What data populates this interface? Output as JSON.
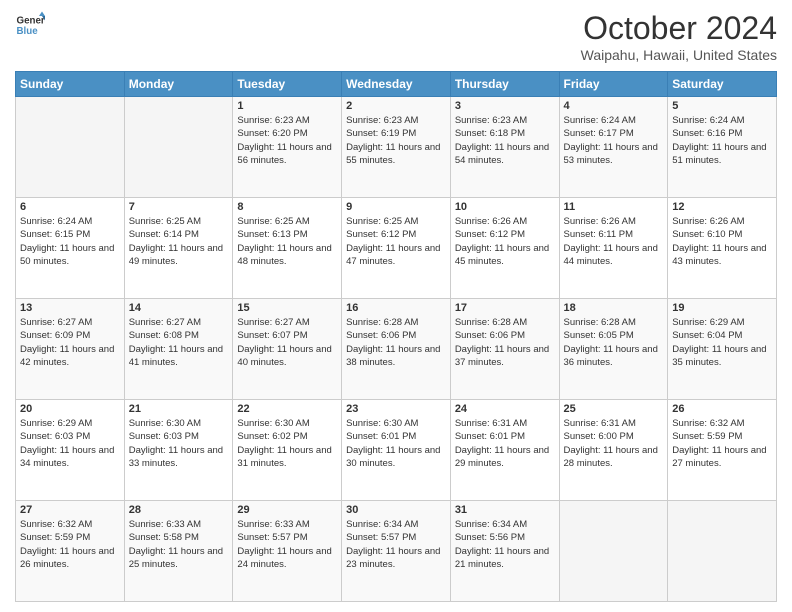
{
  "logo": {
    "line1": "General",
    "line2": "Blue"
  },
  "header": {
    "month": "October 2024",
    "location": "Waipahu, Hawaii, United States"
  },
  "days_of_week": [
    "Sunday",
    "Monday",
    "Tuesday",
    "Wednesday",
    "Thursday",
    "Friday",
    "Saturday"
  ],
  "weeks": [
    [
      {
        "day": "",
        "sunrise": "",
        "sunset": "",
        "daylight": ""
      },
      {
        "day": "",
        "sunrise": "",
        "sunset": "",
        "daylight": ""
      },
      {
        "day": "1",
        "sunrise": "Sunrise: 6:23 AM",
        "sunset": "Sunset: 6:20 PM",
        "daylight": "Daylight: 11 hours and 56 minutes."
      },
      {
        "day": "2",
        "sunrise": "Sunrise: 6:23 AM",
        "sunset": "Sunset: 6:19 PM",
        "daylight": "Daylight: 11 hours and 55 minutes."
      },
      {
        "day": "3",
        "sunrise": "Sunrise: 6:23 AM",
        "sunset": "Sunset: 6:18 PM",
        "daylight": "Daylight: 11 hours and 54 minutes."
      },
      {
        "day": "4",
        "sunrise": "Sunrise: 6:24 AM",
        "sunset": "Sunset: 6:17 PM",
        "daylight": "Daylight: 11 hours and 53 minutes."
      },
      {
        "day": "5",
        "sunrise": "Sunrise: 6:24 AM",
        "sunset": "Sunset: 6:16 PM",
        "daylight": "Daylight: 11 hours and 51 minutes."
      }
    ],
    [
      {
        "day": "6",
        "sunrise": "Sunrise: 6:24 AM",
        "sunset": "Sunset: 6:15 PM",
        "daylight": "Daylight: 11 hours and 50 minutes."
      },
      {
        "day": "7",
        "sunrise": "Sunrise: 6:25 AM",
        "sunset": "Sunset: 6:14 PM",
        "daylight": "Daylight: 11 hours and 49 minutes."
      },
      {
        "day": "8",
        "sunrise": "Sunrise: 6:25 AM",
        "sunset": "Sunset: 6:13 PM",
        "daylight": "Daylight: 11 hours and 48 minutes."
      },
      {
        "day": "9",
        "sunrise": "Sunrise: 6:25 AM",
        "sunset": "Sunset: 6:12 PM",
        "daylight": "Daylight: 11 hours and 47 minutes."
      },
      {
        "day": "10",
        "sunrise": "Sunrise: 6:26 AM",
        "sunset": "Sunset: 6:12 PM",
        "daylight": "Daylight: 11 hours and 45 minutes."
      },
      {
        "day": "11",
        "sunrise": "Sunrise: 6:26 AM",
        "sunset": "Sunset: 6:11 PM",
        "daylight": "Daylight: 11 hours and 44 minutes."
      },
      {
        "day": "12",
        "sunrise": "Sunrise: 6:26 AM",
        "sunset": "Sunset: 6:10 PM",
        "daylight": "Daylight: 11 hours and 43 minutes."
      }
    ],
    [
      {
        "day": "13",
        "sunrise": "Sunrise: 6:27 AM",
        "sunset": "Sunset: 6:09 PM",
        "daylight": "Daylight: 11 hours and 42 minutes."
      },
      {
        "day": "14",
        "sunrise": "Sunrise: 6:27 AM",
        "sunset": "Sunset: 6:08 PM",
        "daylight": "Daylight: 11 hours and 41 minutes."
      },
      {
        "day": "15",
        "sunrise": "Sunrise: 6:27 AM",
        "sunset": "Sunset: 6:07 PM",
        "daylight": "Daylight: 11 hours and 40 minutes."
      },
      {
        "day": "16",
        "sunrise": "Sunrise: 6:28 AM",
        "sunset": "Sunset: 6:06 PM",
        "daylight": "Daylight: 11 hours and 38 minutes."
      },
      {
        "day": "17",
        "sunrise": "Sunrise: 6:28 AM",
        "sunset": "Sunset: 6:06 PM",
        "daylight": "Daylight: 11 hours and 37 minutes."
      },
      {
        "day": "18",
        "sunrise": "Sunrise: 6:28 AM",
        "sunset": "Sunset: 6:05 PM",
        "daylight": "Daylight: 11 hours and 36 minutes."
      },
      {
        "day": "19",
        "sunrise": "Sunrise: 6:29 AM",
        "sunset": "Sunset: 6:04 PM",
        "daylight": "Daylight: 11 hours and 35 minutes."
      }
    ],
    [
      {
        "day": "20",
        "sunrise": "Sunrise: 6:29 AM",
        "sunset": "Sunset: 6:03 PM",
        "daylight": "Daylight: 11 hours and 34 minutes."
      },
      {
        "day": "21",
        "sunrise": "Sunrise: 6:30 AM",
        "sunset": "Sunset: 6:03 PM",
        "daylight": "Daylight: 11 hours and 33 minutes."
      },
      {
        "day": "22",
        "sunrise": "Sunrise: 6:30 AM",
        "sunset": "Sunset: 6:02 PM",
        "daylight": "Daylight: 11 hours and 31 minutes."
      },
      {
        "day": "23",
        "sunrise": "Sunrise: 6:30 AM",
        "sunset": "Sunset: 6:01 PM",
        "daylight": "Daylight: 11 hours and 30 minutes."
      },
      {
        "day": "24",
        "sunrise": "Sunrise: 6:31 AM",
        "sunset": "Sunset: 6:01 PM",
        "daylight": "Daylight: 11 hours and 29 minutes."
      },
      {
        "day": "25",
        "sunrise": "Sunrise: 6:31 AM",
        "sunset": "Sunset: 6:00 PM",
        "daylight": "Daylight: 11 hours and 28 minutes."
      },
      {
        "day": "26",
        "sunrise": "Sunrise: 6:32 AM",
        "sunset": "Sunset: 5:59 PM",
        "daylight": "Daylight: 11 hours and 27 minutes."
      }
    ],
    [
      {
        "day": "27",
        "sunrise": "Sunrise: 6:32 AM",
        "sunset": "Sunset: 5:59 PM",
        "daylight": "Daylight: 11 hours and 26 minutes."
      },
      {
        "day": "28",
        "sunrise": "Sunrise: 6:33 AM",
        "sunset": "Sunset: 5:58 PM",
        "daylight": "Daylight: 11 hours and 25 minutes."
      },
      {
        "day": "29",
        "sunrise": "Sunrise: 6:33 AM",
        "sunset": "Sunset: 5:57 PM",
        "daylight": "Daylight: 11 hours and 24 minutes."
      },
      {
        "day": "30",
        "sunrise": "Sunrise: 6:34 AM",
        "sunset": "Sunset: 5:57 PM",
        "daylight": "Daylight: 11 hours and 23 minutes."
      },
      {
        "day": "31",
        "sunrise": "Sunrise: 6:34 AM",
        "sunset": "Sunset: 5:56 PM",
        "daylight": "Daylight: 11 hours and 21 minutes."
      },
      {
        "day": "",
        "sunrise": "",
        "sunset": "",
        "daylight": ""
      },
      {
        "day": "",
        "sunrise": "",
        "sunset": "",
        "daylight": ""
      }
    ]
  ]
}
